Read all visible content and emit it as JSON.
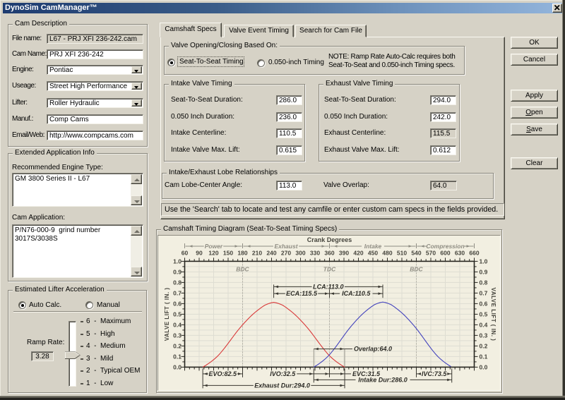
{
  "window": {
    "title": "DynoSim CamManager™",
    "close_glyph": "x"
  },
  "cam_description": {
    "title": "Cam Description",
    "fields": [
      {
        "label": "File name:",
        "value": "L67 - PRJ XFI 236-242.cam",
        "type": "disabled"
      },
      {
        "label": "Cam Name:",
        "value": "PRJ XFI 236-242",
        "type": "input"
      },
      {
        "label": "Engine:",
        "value": "Pontiac",
        "type": "combo"
      },
      {
        "label": "Useage:",
        "value": "Street High Performance",
        "type": "combo"
      },
      {
        "label": "Lifter:",
        "value": "Roller Hydraulic",
        "type": "combo"
      },
      {
        "label": "Manuf.:",
        "value": "Comp Cams",
        "type": "input"
      },
      {
        "label": "Email/Web:",
        "value": "http://www.compcams.com",
        "type": "input"
      }
    ]
  },
  "extended_info": {
    "title": "Extended Application Info",
    "engine_type_label": "Recommended Engine Type:",
    "engine_type_value": "GM 3800 Series II - L67",
    "cam_application_label": "Cam Application:",
    "cam_application_value": "P/N76-000-9  grind number\n3017S/3038S"
  },
  "lifter_accel": {
    "title": "Estimated Lifter Acceleration",
    "radio_auto": "Auto Calc.",
    "radio_manual": "Manual",
    "selected": "Auto Calc.",
    "ramp_rate_label": "Ramp Rate:",
    "ramp_rate_value": "3.28",
    "slider_labels": [
      "6  -  Maximum",
      "5  -  High",
      "4  -  Medium",
      "3  -  Mild",
      "2  -  Typical OEM",
      "1  -  Low"
    ],
    "slider_value": 3.28
  },
  "tabs": [
    {
      "label": "Camshaft Specs",
      "active": true
    },
    {
      "label": "Valve Event Timing",
      "active": false
    },
    {
      "label": "Search for Cam File",
      "active": false
    }
  ],
  "valve_basis": {
    "title": "Valve Opening/Closing Based On:",
    "radio_seat": "Seat-To-Seat Timing",
    "radio_050": "0.050-inch Timing",
    "selected": "Seat-To-Seat Timing",
    "note_line1": "NOTE: Ramp Rate Auto-Calc requires both",
    "note_line2": "Seat-To-Seat and 0.050-inch Timing specs."
  },
  "intake_group": {
    "title": "Intake Valve Timing",
    "rows": [
      {
        "label": "Seat-To-Seat Duration:",
        "value": "286.0",
        "disabled": false
      },
      {
        "label": "0.050 Inch Duration:",
        "value": "236.0",
        "disabled": false
      },
      {
        "label": "Intake Centerline:",
        "value": "110.5",
        "disabled": false
      },
      {
        "label": "Intake Valve Max. Lift:",
        "value": "0.615",
        "disabled": false
      }
    ]
  },
  "exhaust_group": {
    "title": "Exhaust Valve Timing",
    "rows": [
      {
        "label": "Seat-To-Seat Duration:",
        "value": "294.0",
        "disabled": false
      },
      {
        "label": "0.050 Inch Duration:",
        "value": "242.0",
        "disabled": false
      },
      {
        "label": "Exhaust Centerline:",
        "value": "115.5",
        "disabled": true
      },
      {
        "label": "Exhaust Valve Max. Lift:",
        "value": "0.612",
        "disabled": false
      }
    ]
  },
  "lobe_group": {
    "title": "Intake/Exhaust Lobe Relationships",
    "lca_label": "Cam Lobe-Center Angle:",
    "lca_value": "113.0",
    "overlap_label": "Valve Overlap:",
    "overlap_value": "64.0"
  },
  "note_strip": "Use the 'Search' tab to locate and test any camfile or enter custom cam specs in the fields provided.",
  "buttons": [
    {
      "label": "OK",
      "accel": -1
    },
    {
      "label": "Cancel",
      "accel": -1
    },
    {
      "label": "Apply",
      "accel": -1
    },
    {
      "label": "Open",
      "accel": 0
    },
    {
      "label": "Save",
      "accel": 0
    },
    {
      "label": "Clear",
      "accel": -1
    }
  ],
  "chart_group_title": "Camshaft Timing Diagram (Seat-To-Seat Timing Specs)",
  "chart_data": {
    "type": "line",
    "title": "Crank Degrees",
    "ylabel": "VALVE LIFT ( IN. )",
    "xlim": [
      60,
      660
    ],
    "ylim": [
      0.0,
      1.0
    ],
    "x_major_ticks": 30,
    "x_minor_ticks": 10,
    "y_major_ticks": 0.1,
    "y_minor_ticks": 0.05,
    "grid_x_step": 30,
    "grid_y_step": 0.05,
    "phases": [
      {
        "label": "Power",
        "from": 60,
        "to": 180
      },
      {
        "label": "Exhaust",
        "from": 180,
        "to": 360
      },
      {
        "label": "Intake",
        "from": 360,
        "to": 540
      },
      {
        "label": "Compression",
        "from": 540,
        "to": 660
      }
    ],
    "dead_centers": [
      {
        "label": "BDC",
        "x": 180
      },
      {
        "label": "TDC",
        "x": 360
      },
      {
        "label": "BDC",
        "x": 540
      }
    ],
    "series": [
      {
        "name": "exhaust",
        "color": "#d93a3a",
        "open_deg": 97.5,
        "close_deg": 391.5,
        "max_lift": 0.612
      },
      {
        "name": "intake",
        "color": "#4343bd",
        "open_deg": 327.5,
        "close_deg": 613.5,
        "max_lift": 0.615
      }
    ],
    "lift_profile": [
      0.0,
      0.026,
      0.055,
      0.086,
      0.121,
      0.16,
      0.206,
      0.258,
      0.313,
      0.371,
      0.43,
      0.489,
      0.547,
      0.601,
      0.652,
      0.7,
      0.746,
      0.79,
      0.83,
      0.866,
      0.9,
      0.932,
      0.96,
      0.978,
      0.992,
      1.0
    ],
    "annotations": {
      "lca": {
        "label": "LCA:113.0",
        "from": 244.5,
        "to": 470.5,
        "y": 0.76
      },
      "eca": {
        "label": "ECA:115.5",
        "from": 244.5,
        "to": 360,
        "y": 0.695
      },
      "ica": {
        "label": "ICA:110.5",
        "from": 360,
        "to": 470.5,
        "y": 0.695
      },
      "overlap": {
        "label": "Overlap:64.0",
        "from": 327.5,
        "to": 391.5,
        "y": 0.172
      },
      "evo": {
        "label": "EVO:82.5",
        "from": 97.5,
        "to": 180
      },
      "ivo": {
        "label": "IVO:32.5",
        "from": 327.5,
        "to": 360
      },
      "evc": {
        "label": "EVC:31.5",
        "from": 360,
        "to": 391.5
      },
      "ivc": {
        "label": "IVC:73.5",
        "from": 540,
        "to": 613.5
      },
      "intake_dur": {
        "label": "Intake Dur:286.0",
        "from": 327.5,
        "to": 613.5
      },
      "exhaust_dur": {
        "label": "Exhaust Dur:294.0",
        "from": 97.5,
        "to": 391.5
      }
    }
  }
}
